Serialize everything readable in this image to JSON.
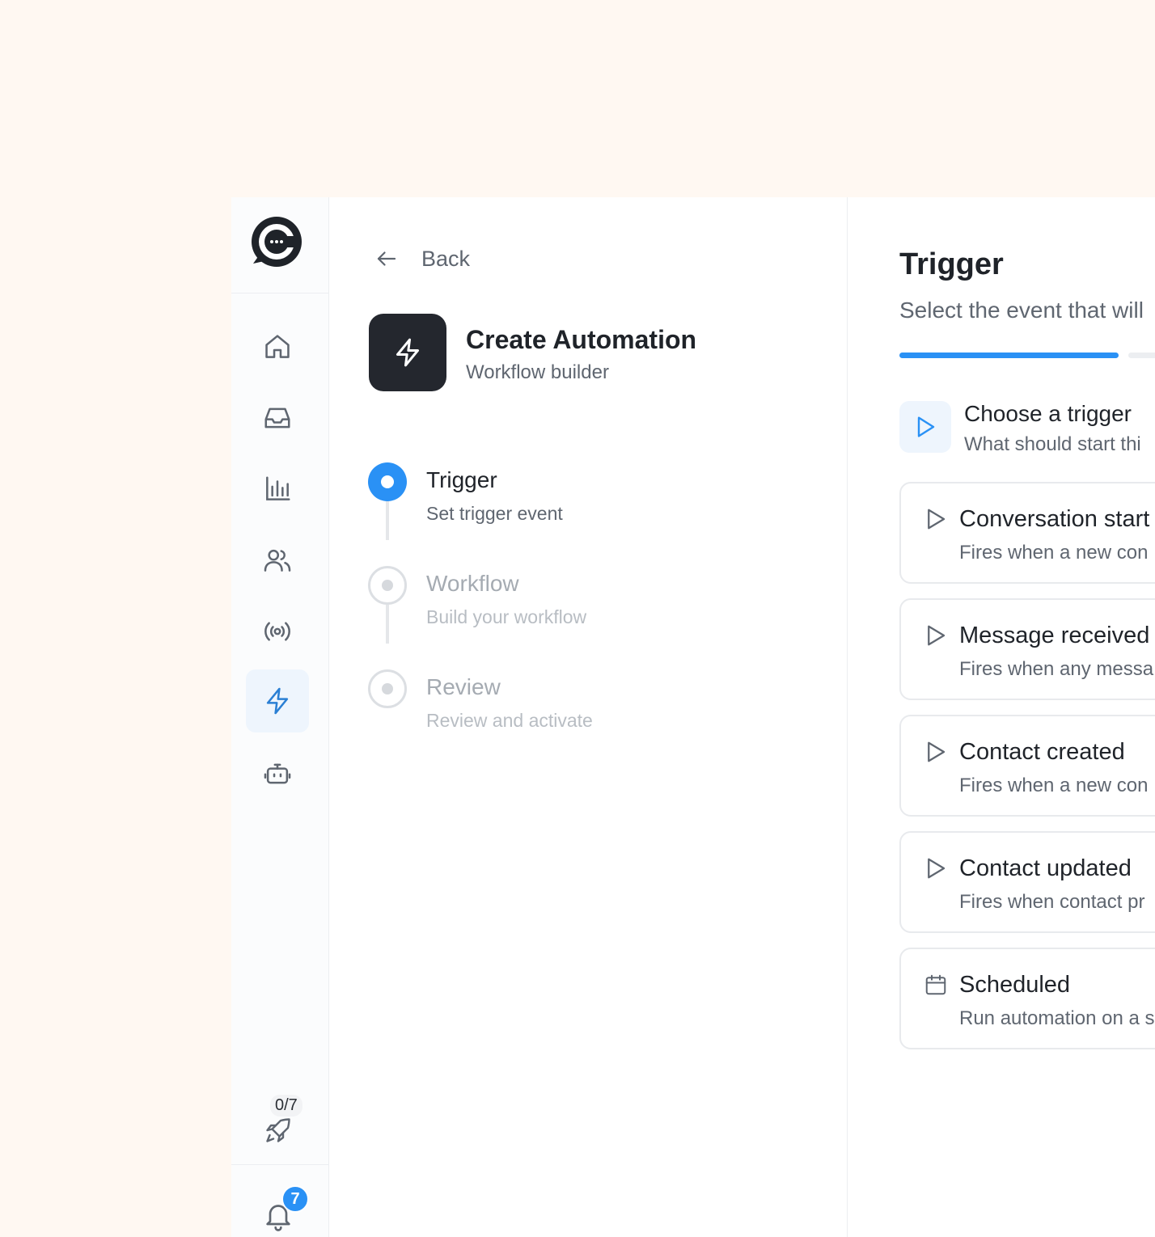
{
  "sidebar": {
    "nav": [
      {
        "icon": "home-icon"
      },
      {
        "icon": "inbox-icon"
      },
      {
        "icon": "reports-icon"
      },
      {
        "icon": "contacts-icon"
      },
      {
        "icon": "broadcast-icon"
      },
      {
        "icon": "automation-bolt-icon",
        "active": true
      },
      {
        "icon": "bot-icon"
      }
    ],
    "onboarding_progress": "0/7",
    "notification_count": "7"
  },
  "steps_panel": {
    "back_label": "Back",
    "title": "Create Automation",
    "subtitle": "Workflow builder",
    "steps": [
      {
        "title": "Trigger",
        "subtitle": "Set trigger event",
        "state": "current"
      },
      {
        "title": "Workflow",
        "subtitle": "Build your workflow",
        "state": "future"
      },
      {
        "title": "Review",
        "subtitle": "Review and activate",
        "state": "future"
      }
    ]
  },
  "trigger_panel": {
    "title": "Trigger",
    "subtitle": "Select the event that will",
    "choose_title": "Choose a trigger",
    "choose_subtitle": "What should start thi",
    "options": [
      {
        "title": "Conversation start",
        "subtitle": "Fires when a new con",
        "icon": "play-icon"
      },
      {
        "title": "Message received",
        "subtitle": "Fires when any messa",
        "icon": "play-icon"
      },
      {
        "title": "Contact created",
        "subtitle": "Fires when a new con",
        "icon": "play-icon"
      },
      {
        "title": "Contact updated",
        "subtitle": "Fires when contact pr",
        "icon": "play-icon"
      },
      {
        "title": "Scheduled",
        "subtitle": "Run automation on a s",
        "icon": "calendar-icon"
      }
    ]
  },
  "colors": {
    "accent": "#2a91f5",
    "dark": "#24272e",
    "page_bg": "#fff8f2"
  }
}
